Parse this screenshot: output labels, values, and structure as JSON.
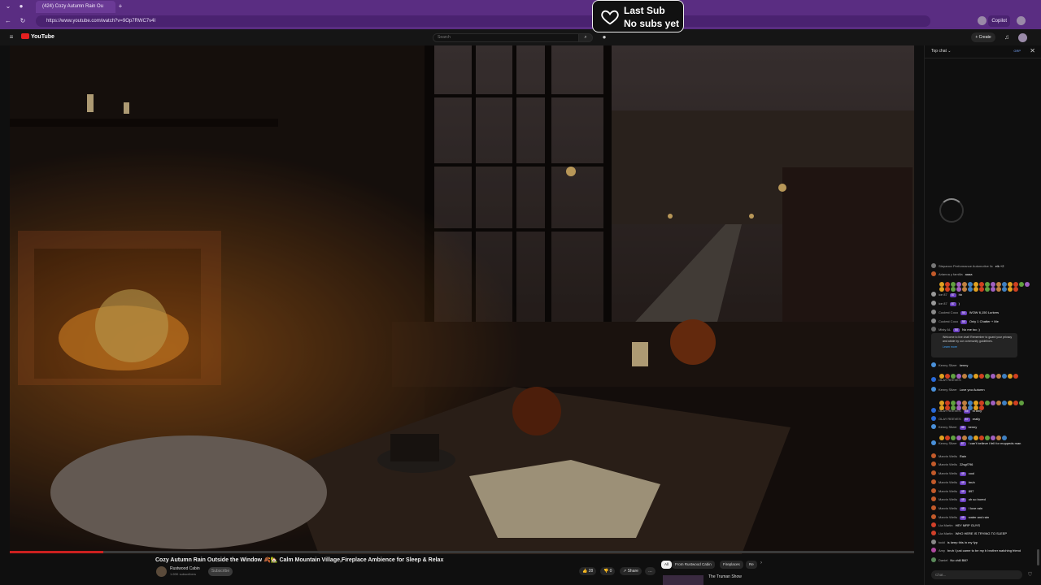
{
  "browser": {
    "tab_title": "(424) Cozy Autumn Rain Ou",
    "url": "https://www.youtube.com/watch?v=9Op7RWC7v4I",
    "copilot_label": "Copilot"
  },
  "youtube": {
    "logo_text": "YouTube",
    "search_placeholder": "Search",
    "create_label": "+ Create"
  },
  "sub_widget": {
    "line1": "Last Sub",
    "line2": "No subs yet"
  },
  "video": {
    "title": "Cozy Autumn Rain Outside the Window 🍂🏡 Calm Mountain Village,Fireplace Ambience for Sleep & Relax",
    "channel_name": "Rustwood Cabin",
    "channel_subs": "1.69K subscribers",
    "subscribe_label": "Subscribe",
    "likes": "28",
    "dislikes": "0",
    "share_label": "Share",
    "more_label": "…",
    "chips": [
      "All",
      "From Rustwood Cabin",
      "Fireplaces",
      "Re"
    ],
    "rec_title": "The Truman Show"
  },
  "chat": {
    "header": "Top chat",
    "header_btn": "GRP",
    "input_placeholder": "Chat...",
    "notice_text": "Welcome to live chat! Remember to guard your privacy and abide by our community guidelines.",
    "notice_link": "Learn more",
    "messages": [
      {
        "name": "Stepanov Performance Automotive llc",
        "badge": "",
        "text": "elk +2"
      },
      {
        "name": "Arianna y familia",
        "badge": "",
        "text": "aaaa"
      },
      {
        "name": "ice 87",
        "badge": "87",
        "text": "hb"
      },
      {
        "name": "ice 87",
        "badge": "87",
        "text": ")"
      },
      {
        "name": "Coolest Coco",
        "badge": "50",
        "text": "WOW 6,150 Lurkers"
      },
      {
        "name": "Coolest Coco",
        "badge": "50",
        "text": "Only 1 Chatter + Me"
      },
      {
        "name": "Misty AL",
        "badge": "50",
        "text": "No me toc ;)"
      },
      {
        "name": "Kenny Sltzer",
        "badge": "",
        "text": "kenny"
      },
      {
        "name": "OLAY REEVES",
        "badge": "",
        "text": ""
      },
      {
        "name": "Kenny Sltzer",
        "badge": "",
        "text": "Love you Autumn"
      },
      {
        "name": "OLAY REEVES",
        "badge": "45",
        "text": "hi only"
      },
      {
        "name": "OLAY REEVES",
        "badge": "87",
        "text": "really"
      },
      {
        "name": "Kenny Sltzer",
        "badge": "45",
        "text": "kenny"
      },
      {
        "name": "Kenny Sltzer",
        "badge": "87",
        "text": "I can't believe i fell for moppeds man"
      },
      {
        "name": "Marvin Wells",
        "badge": "",
        "text": "Rain"
      },
      {
        "name": "Marvin Wells",
        "badge": "",
        "text": "22sgf796"
      },
      {
        "name": "Marvin Wells",
        "badge": "45",
        "text": "cool"
      },
      {
        "name": "Marvin Wells",
        "badge": "45",
        "text": "bruh"
      },
      {
        "name": "Marvin Wells",
        "badge": "45",
        "text": "897"
      },
      {
        "name": "Marvin Wells",
        "badge": "45",
        "text": "oh so bored"
      },
      {
        "name": "Marvin Wells",
        "badge": "45",
        "text": "I love rain"
      },
      {
        "name": "Marvin Wells",
        "badge": "45",
        "text": "water and rain"
      },
      {
        "name": "Lia Martin",
        "badge": "",
        "text": "HEY MRP GUYS"
      },
      {
        "name": "Lia Martin",
        "badge": "",
        "text": "WHO HERE IS TRYING TO SLEEP"
      },
      {
        "name": "todd",
        "badge": "",
        "text": "is keep this in my fyp"
      },
      {
        "name": "Amy",
        "badge": "",
        "text": "bruh I just came to be my b brother watching friend"
      },
      {
        "name": "Daniel",
        "badge": "",
        "text": "No chill Bill?"
      }
    ]
  }
}
